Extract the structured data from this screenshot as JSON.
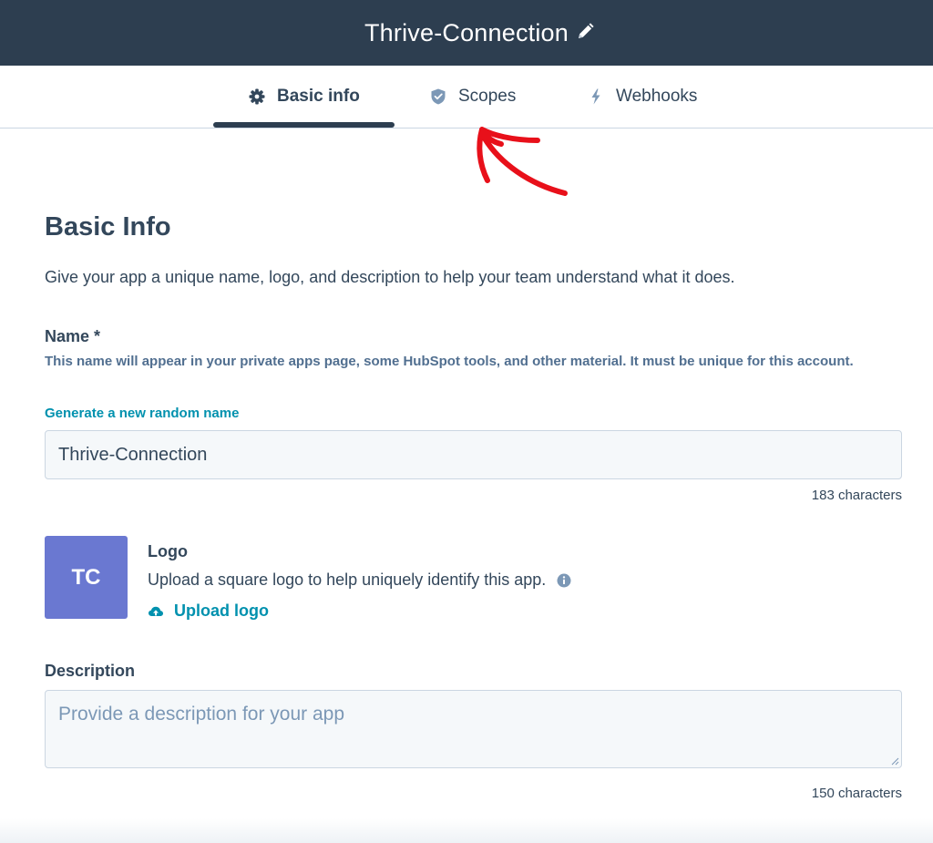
{
  "header": {
    "app_name": "Thrive-Connection",
    "edit_icon": "pencil-icon"
  },
  "tabs": [
    {
      "label": "Basic info",
      "icon": "gear-icon",
      "active": true
    },
    {
      "label": "Scopes",
      "icon": "shield-icon",
      "active": false
    },
    {
      "label": "Webhooks",
      "icon": "lightning-icon",
      "active": false
    }
  ],
  "annotation": {
    "type": "red-hand-drawn-arrow",
    "color": "#e8101a",
    "points_to": "Scopes"
  },
  "basic_info": {
    "title": "Basic Info",
    "description": "Give your app a unique name, logo, and description to help your team understand what it does."
  },
  "name_field": {
    "label": "Name *",
    "help": "This name will appear in your private apps page, some HubSpot tools, and other material. It must be unique for this account.",
    "generate_link": "Generate a new random name",
    "value": "Thrive-Connection",
    "char_count": "183 characters"
  },
  "logo": {
    "initials": "TC",
    "tile_color": "#6a78d1",
    "label": "Logo",
    "description": "Upload a square logo to help uniquely identify this app.",
    "info_icon": "info-icon",
    "upload_label": "Upload logo",
    "upload_icon": "cloud-upload-icon"
  },
  "description_field": {
    "label": "Description",
    "placeholder": "Provide a description for your app",
    "char_count": "150 characters"
  },
  "colors": {
    "header_bg": "#2d3e50",
    "text": "#33475b",
    "link": "#0091ae",
    "input_bg": "#f5f8fa",
    "border": "#cbd6e2"
  }
}
